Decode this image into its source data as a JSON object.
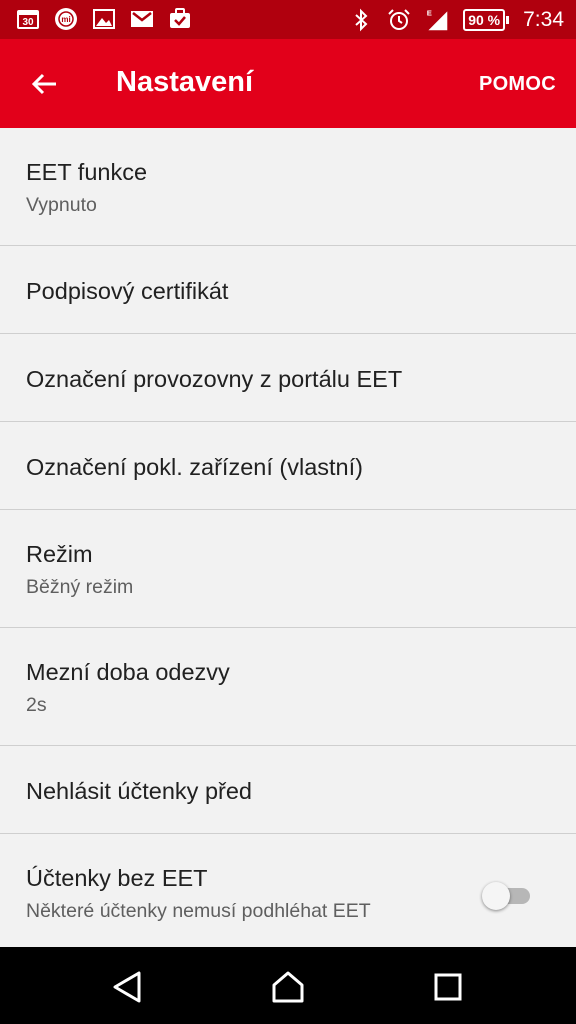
{
  "status_bar": {
    "calendar_day": "30",
    "mi_label": "mi",
    "network_type": "E",
    "battery": "90 %",
    "time": "7:34",
    "icons": [
      "calendar-icon",
      "mi-app-icon",
      "image-icon",
      "gmail-icon",
      "task-icon",
      "bluetooth-icon",
      "alarm-icon",
      "signal-icon",
      "battery-icon"
    ]
  },
  "app_bar": {
    "title": "Nastavení",
    "help_label": "POMOC",
    "back_icon": "arrow-left-icon",
    "color": "#e2001a",
    "status_color": "#b0000e"
  },
  "settings": [
    {
      "title": "EET funkce",
      "subtitle": "Vypnuto"
    },
    {
      "title": "Podpisový certifikát"
    },
    {
      "title": "Označení provozovny z portálu EET"
    },
    {
      "title": "Označení pokl. zařízení (vlastní)"
    },
    {
      "title": "Režim",
      "subtitle": "Běžný režim"
    },
    {
      "title": "Mezní doba odezvy",
      "subtitle": "2s"
    },
    {
      "title": "Nehlásit účtenky před"
    },
    {
      "title": "Účtenky bez EET",
      "subtitle": "Některé účtenky nemusí podhléhat EET",
      "toggle": false
    }
  ],
  "nav_bar": {
    "icons": [
      "back-triangle-icon",
      "home-icon",
      "recents-icon"
    ]
  }
}
